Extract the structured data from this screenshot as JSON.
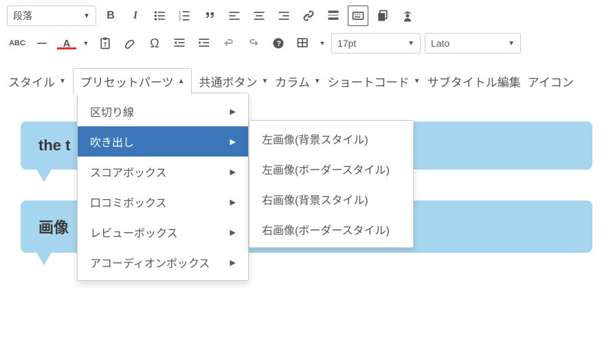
{
  "format_select": "段落",
  "fontsize_select": "17pt",
  "fontfamily_select": "Lato",
  "secondary_menu": {
    "items": [
      {
        "label": "スタイル",
        "caret": "▼"
      },
      {
        "label": "プリセットパーツ",
        "caret": "▲"
      },
      {
        "label": "共通ボタン",
        "caret": "▼"
      },
      {
        "label": "カラム",
        "caret": "▼"
      },
      {
        "label": "ショートコード",
        "caret": "▼"
      },
      {
        "label": "サブタイトル編集",
        "caret": ""
      },
      {
        "label": "アイコン",
        "caret": ""
      }
    ]
  },
  "dropdown": {
    "items": [
      {
        "label": "区切り線"
      },
      {
        "label": "吹き出し"
      },
      {
        "label": "スコアボックス"
      },
      {
        "label": "口コミボックス"
      },
      {
        "label": "レビューボックス"
      },
      {
        "label": "アコーディオンボックス"
      }
    ]
  },
  "submenu": {
    "items": [
      {
        "label": "左画像(背景スタイル)"
      },
      {
        "label": "左画像(ボーダースタイル)"
      },
      {
        "label": "右画像(背景スタイル)"
      },
      {
        "label": "右画像(ボーダースタイル)"
      }
    ]
  },
  "canvas": {
    "bubble1": "the t",
    "bubble2": "画像"
  }
}
